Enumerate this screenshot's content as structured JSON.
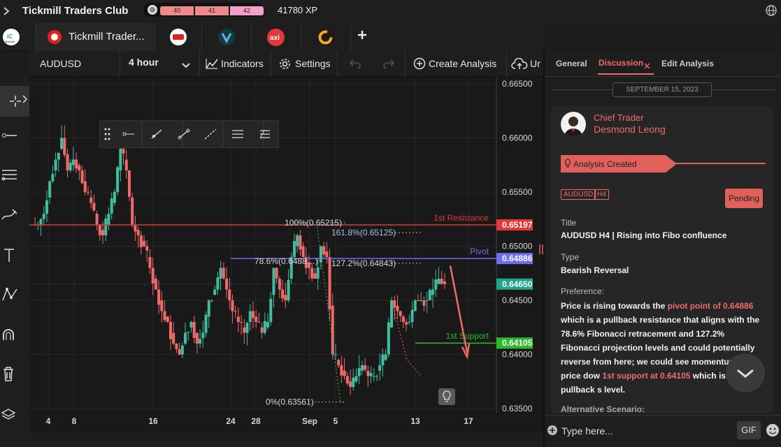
{
  "app": {
    "title": "Tickmill Traders Club",
    "levels": [
      "40",
      "41",
      "42"
    ],
    "xp": "41780 XP"
  },
  "tabs": [
    {
      "label": "",
      "icon": "ic-markets-logo"
    },
    {
      "label": "Tickmill Trader...",
      "icon": "tickmill-logo"
    },
    {
      "label": "",
      "icon": "broker-logo-red"
    },
    {
      "label": "",
      "icon": "vantage-logo"
    },
    {
      "label": "",
      "icon": "axi-logo"
    },
    {
      "label": "",
      "icon": "g-logo"
    }
  ],
  "toolbar": {
    "symbol": "AUDUSD",
    "timeframe": "4 hour",
    "indicators": "Indicators",
    "settings": "Settings",
    "create_analysis": "Create Analysis",
    "upload_partial": "Ur"
  },
  "chart_data": {
    "type": "candlestick",
    "symbol": "AUDUSD",
    "timeframe": "4 hour",
    "ylim": [
      0.635,
      0.665
    ],
    "y_ticks": [
      "0.66500",
      "0.66000",
      "0.65500",
      "0.65000",
      "0.64500",
      "0.64000",
      "0.63500"
    ],
    "x_ticks": [
      "4",
      "8",
      "16",
      "24",
      "28",
      "Sep",
      "5",
      "13",
      "17"
    ],
    "close_series": [
      0.652,
      0.653,
      0.656,
      0.658,
      0.66,
      0.657,
      0.658,
      0.657,
      0.655,
      0.654,
      0.652,
      0.651,
      0.653,
      0.655,
      0.659,
      0.657,
      0.652,
      0.651,
      0.65,
      0.648,
      0.646,
      0.644,
      0.643,
      0.641,
      0.64,
      0.642,
      0.643,
      0.641,
      0.642,
      0.645,
      0.646,
      0.648,
      0.646,
      0.644,
      0.643,
      0.642,
      0.644,
      0.643,
      0.642,
      0.643,
      0.648,
      0.646,
      0.645,
      0.649,
      0.651,
      0.649,
      0.648,
      0.647,
      0.65,
      0.649,
      0.64,
      0.639,
      0.638,
      0.637,
      0.638,
      0.639,
      0.638,
      0.638,
      0.639,
      0.64,
      0.645,
      0.644,
      0.643,
      0.643,
      0.645,
      0.645,
      0.645,
      0.646,
      0.647,
      0.6465
    ],
    "levels": [
      {
        "name": "1st Resistance",
        "value": "0.65197",
        "color": "#e03a3a"
      },
      {
        "name": "Pivot",
        "value": "0.64886",
        "color": "#6e6ef0"
      },
      {
        "name": "1st Support",
        "value": "0.64105",
        "color": "#2eb82e"
      }
    ],
    "current_price": "0.64650",
    "fibonacci": [
      "100%(0.65215)",
      "161.8%(0.65125)",
      "78.6%(0.6488…)",
      "127.2%(0.64843)",
      "0%(0.63561)"
    ]
  },
  "right_panel": {
    "tabs": [
      "General",
      "Discussion",
      "Edit Analysis"
    ],
    "active_tab": "Discussion",
    "date": "SEPTEMBER 15, 2023",
    "author_role": "Chief Trader",
    "author_name": "Desmond Leong",
    "event": "Analysis Created",
    "tags": [
      "AUDUSD",
      "H4"
    ],
    "status": "Pending",
    "title_label": "Title",
    "title_value": "AUDUSD H4 | Rising into Fibo confluence",
    "type_label": "Type",
    "type_value": "Bearish Reversal",
    "preference_label": "Preference:",
    "pref_1": "Price is rising towards the ",
    "pref_hl1": "pivot point of 0.64886",
    "pref_2": " which is a pullback resistance that aligns with the 78.6% Fibonacci retracement and 127.2% Fibonacci projection levels and could potentially reverse from here; we could see momentum carry price dow",
    "pref_hl2": "1st support at 0.64105",
    "pref_3": " which is a pullback s level.",
    "alt_label": "Alternative Scenario:",
    "input_placeholder": "Type here...",
    "gif_label": "GIF"
  }
}
